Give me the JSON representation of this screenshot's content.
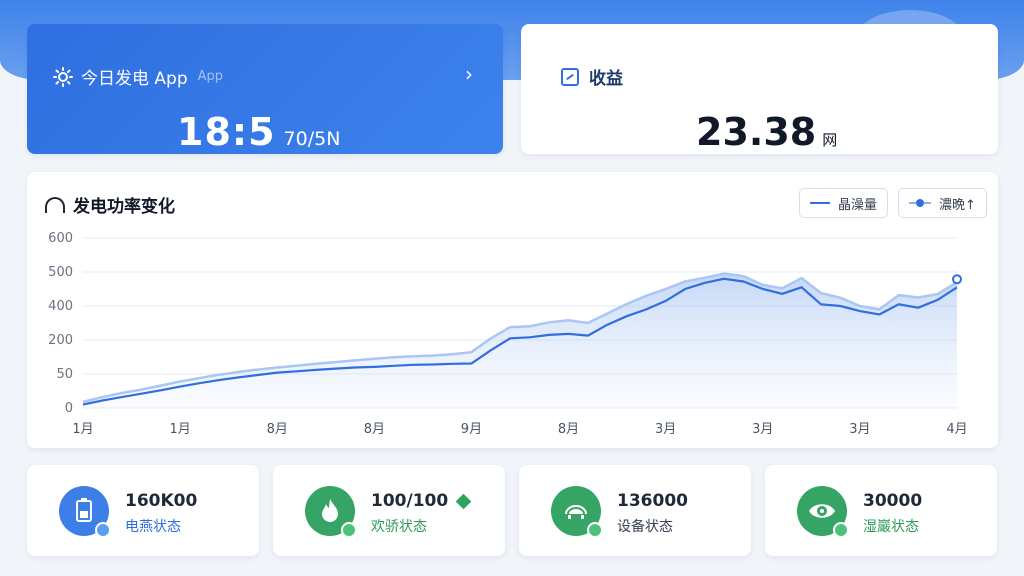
{
  "today": {
    "title": "今日发电 App",
    "title_ghost": "App",
    "value": "18:5",
    "unit": "70/5N",
    "arrow": "›"
  },
  "income": {
    "title": "收益",
    "value": "23.38",
    "unit": "网"
  },
  "chart_card": {
    "title": "发电功率变化",
    "legend": [
      "晶澡量",
      "濃晩↑"
    ]
  },
  "chart_data": {
    "type": "area",
    "title": "发电功率变化",
    "y_ticks": [
      "0",
      "50",
      "200",
      "400",
      "500",
      "600"
    ],
    "x_ticks": [
      "1月",
      "1月",
      "8月",
      "8月",
      "9月",
      "8月",
      "3月",
      "3月",
      "3月",
      "4月"
    ],
    "x": [
      0,
      0.2,
      0.4,
      0.6,
      0.8,
      1.0,
      1.2,
      1.4,
      1.6,
      1.8,
      2.0,
      2.2,
      2.4,
      2.6,
      2.8,
      3.0,
      3.2,
      3.4,
      3.6,
      3.8,
      4.0,
      4.2,
      4.4,
      4.6,
      4.8,
      5.0,
      5.2,
      5.4,
      5.6,
      5.8,
      6.0,
      6.2,
      6.4,
      6.6,
      6.8,
      7.0,
      7.2,
      7.4,
      7.6,
      7.8,
      8.0,
      8.2,
      8.4,
      8.6,
      8.8,
      9.0
    ],
    "series": [
      {
        "values": [
          10,
          22,
          32,
          42,
          52,
          63,
          73,
          82,
          90,
          97,
          104,
          108,
          112,
          116,
          119,
          121,
          124,
          127,
          128,
          130,
          131,
          170,
          205,
          208,
          215,
          218,
          213,
          245,
          270,
          290,
          315,
          350,
          368,
          380,
          372,
          350,
          336,
          355,
          305,
          300,
          285,
          275,
          305,
          295,
          318,
          355
        ],
        "color": "#2f6fe0"
      },
      {
        "values": [
          18,
          32,
          44,
          54,
          66,
          78,
          88,
          98,
          106,
          113,
          119,
          124,
          130,
          135,
          140,
          145,
          149,
          152,
          154,
          158,
          164,
          205,
          238,
          240,
          252,
          258,
          250,
          278,
          306,
          330,
          350,
          372,
          383,
          395,
          388,
          362,
          352,
          382,
          338,
          324,
          300,
          290,
          332,
          325,
          335,
          370
        ],
        "color": "#a9c6f4"
      }
    ],
    "ylim": [
      0,
      500
    ],
    "grid": true
  },
  "stats": [
    {
      "value": "160K00",
      "label": "电燕状态",
      "icon": "battery-icon",
      "label_color": "blue"
    },
    {
      "value": "100/100",
      "label": "欢骄状态",
      "icon": "flame-icon",
      "label_color": "green"
    },
    {
      "value": "136000",
      "label": "设备状态",
      "icon": "turtle-icon",
      "label_color": "dark"
    },
    {
      "value": "30000",
      "label": "湿巖状态",
      "icon": "eye-icon",
      "label_color": "green"
    }
  ],
  "colors": {
    "primary": "#2f6fe0",
    "success": "#35a464",
    "background": "#f1f4f9"
  }
}
